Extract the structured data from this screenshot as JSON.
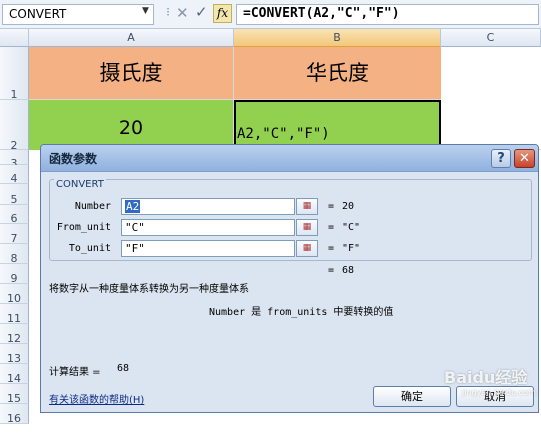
{
  "formula_bar": {
    "name_box": "CONVERT",
    "formula": "=CONVERT(A2,\"C\",\"F\")",
    "fx_label": "fx",
    "cancel_glyph": "✕",
    "enter_glyph": "✓"
  },
  "columns": [
    "A",
    "B",
    "C"
  ],
  "rows": [
    "1",
    "2",
    "3",
    "4",
    "5",
    "6",
    "7",
    "8",
    "9",
    "10",
    "11",
    "12",
    "13",
    "14",
    "15",
    "16"
  ],
  "cells": {
    "a1": "摄氏度",
    "b1": "华氏度",
    "a2": "20",
    "b2": "A2,\"C\",\"F\")"
  },
  "colors": {
    "header_fill": "#f4b183",
    "value_fill": "#92d050",
    "dialog_bg": "#dbe5f1"
  },
  "dialog": {
    "title": "函数参数",
    "help_label": "?",
    "close_label": "✕",
    "function_name": "CONVERT",
    "args": [
      {
        "name": "Number",
        "input": "A2",
        "value": "20"
      },
      {
        "name": "From_unit",
        "input": "\"C\"",
        "value": "\"C\""
      },
      {
        "name": "To_unit",
        "input": "\"F\"",
        "value": "\"F\""
      }
    ],
    "equals": "=",
    "result": "68",
    "description": "将数字从一种度量体系转换为另一种度量体系",
    "arg_description": "Number 是 from_units 中要转换的值",
    "calc_label": "计算结果 =",
    "calc_value": "68",
    "help_link": "有关该函数的帮助(H)",
    "ok_label": "确定",
    "cancel_label": "取消"
  },
  "watermark": {
    "text": "Baidu经验",
    "subtext": "jingyan.baidu.com"
  }
}
